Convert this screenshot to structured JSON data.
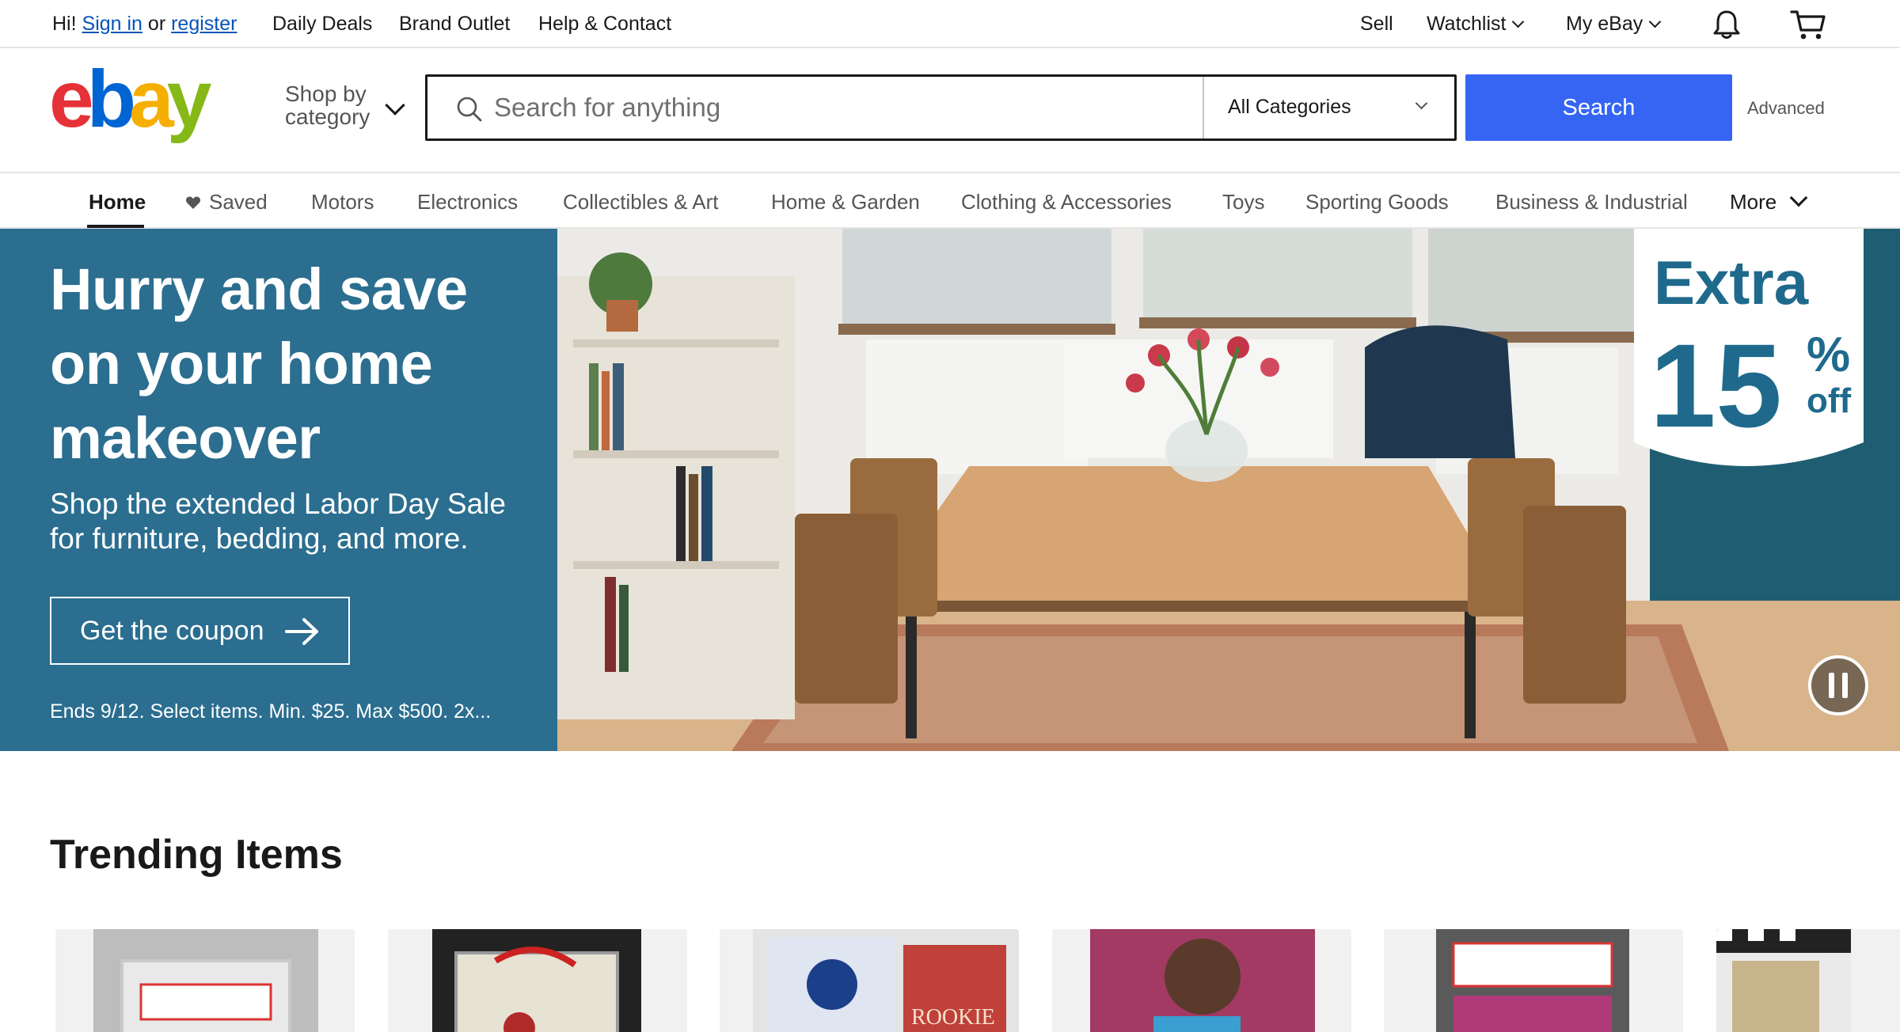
{
  "topbar": {
    "greeting": "Hi!",
    "sign_in": "Sign in",
    "or": "or",
    "register": "register",
    "links": [
      "Daily Deals",
      "Brand Outlet",
      "Help & Contact"
    ],
    "sell": "Sell",
    "watchlist": "Watchlist",
    "my_ebay": "My eBay",
    "notification_icon": "bell-icon",
    "cart_icon": "cart-icon"
  },
  "header": {
    "logo_text": "ebay",
    "shop_by_line1": "Shop by",
    "shop_by_line2": "category",
    "search": {
      "placeholder": "Search for anything",
      "value": "",
      "category": "All Categories"
    },
    "search_button": "Search",
    "advanced": "Advanced"
  },
  "nav": {
    "tabs": [
      {
        "label": "Home"
      },
      {
        "label": "Saved"
      },
      {
        "label": "Motors"
      },
      {
        "label": "Electronics"
      },
      {
        "label": "Collectibles & Art"
      },
      {
        "label": "Home & Garden"
      },
      {
        "label": "Clothing & Accessories"
      },
      {
        "label": "Toys"
      },
      {
        "label": "Sporting Goods"
      },
      {
        "label": "Business & Industrial"
      },
      {
        "label": "More"
      }
    ]
  },
  "hero": {
    "title": "Hurry and save on your home makeover",
    "subtitle": "Shop the extended Labor Day Sale for furniture, bedding, and more.",
    "cta": "Get the coupon",
    "fine_print": "Ends 9/12. Select items. Min. $25. Max $500. 2x...",
    "badge": {
      "line1": "Extra",
      "number": "15",
      "percent": "%",
      "off": "off"
    },
    "colors": {
      "panel": "#2b6e8f",
      "badge_text": "#1f6a8c"
    }
  },
  "trending": {
    "title": "Trending Items"
  },
  "colors": {
    "accent": "#3665f3",
    "link": "#0654ba"
  }
}
